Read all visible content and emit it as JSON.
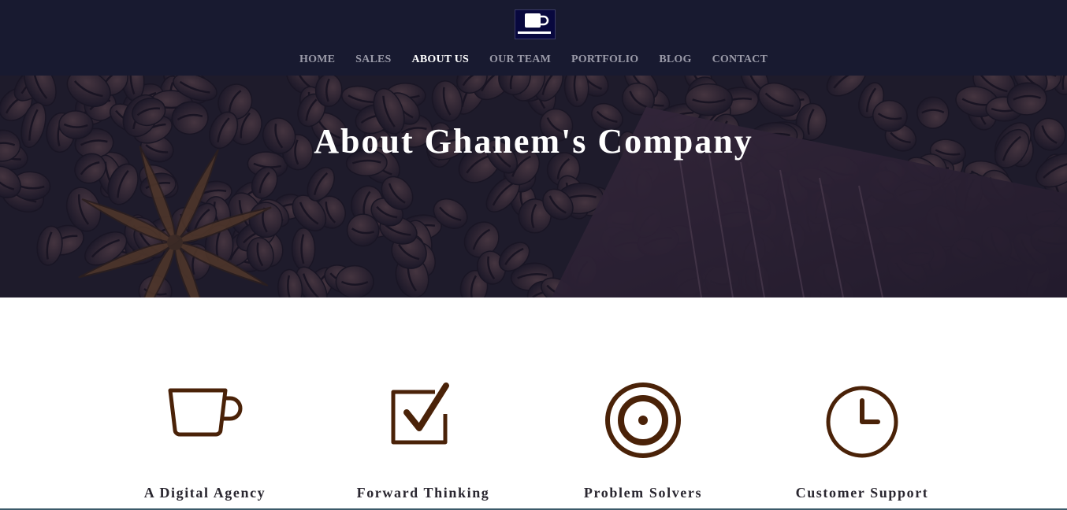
{
  "brand": {
    "logo_icon": "coffee-cup-icon",
    "logo_bg": "#08083e"
  },
  "nav": {
    "items": [
      {
        "label": "HOME"
      },
      {
        "label": "SALES"
      },
      {
        "label": "ABOUT US",
        "active": true
      },
      {
        "label": "OUR TEAM"
      },
      {
        "label": "PORTFOLIO"
      },
      {
        "label": "BLOG"
      },
      {
        "label": "CONTACT"
      }
    ]
  },
  "hero": {
    "title": "About Ghanem's Company"
  },
  "features": [
    {
      "icon": "coffee-cup-icon",
      "label": "A Digital Agency"
    },
    {
      "icon": "checkbox-icon",
      "label": "Forward Thinking"
    },
    {
      "icon": "target-icon",
      "label": "Problem Solvers"
    },
    {
      "icon": "clock-icon",
      "label": "Customer Support"
    }
  ],
  "colors": {
    "header": "#181a30",
    "icon_brown": "#4a2208",
    "text_dark": "#2a2730"
  }
}
